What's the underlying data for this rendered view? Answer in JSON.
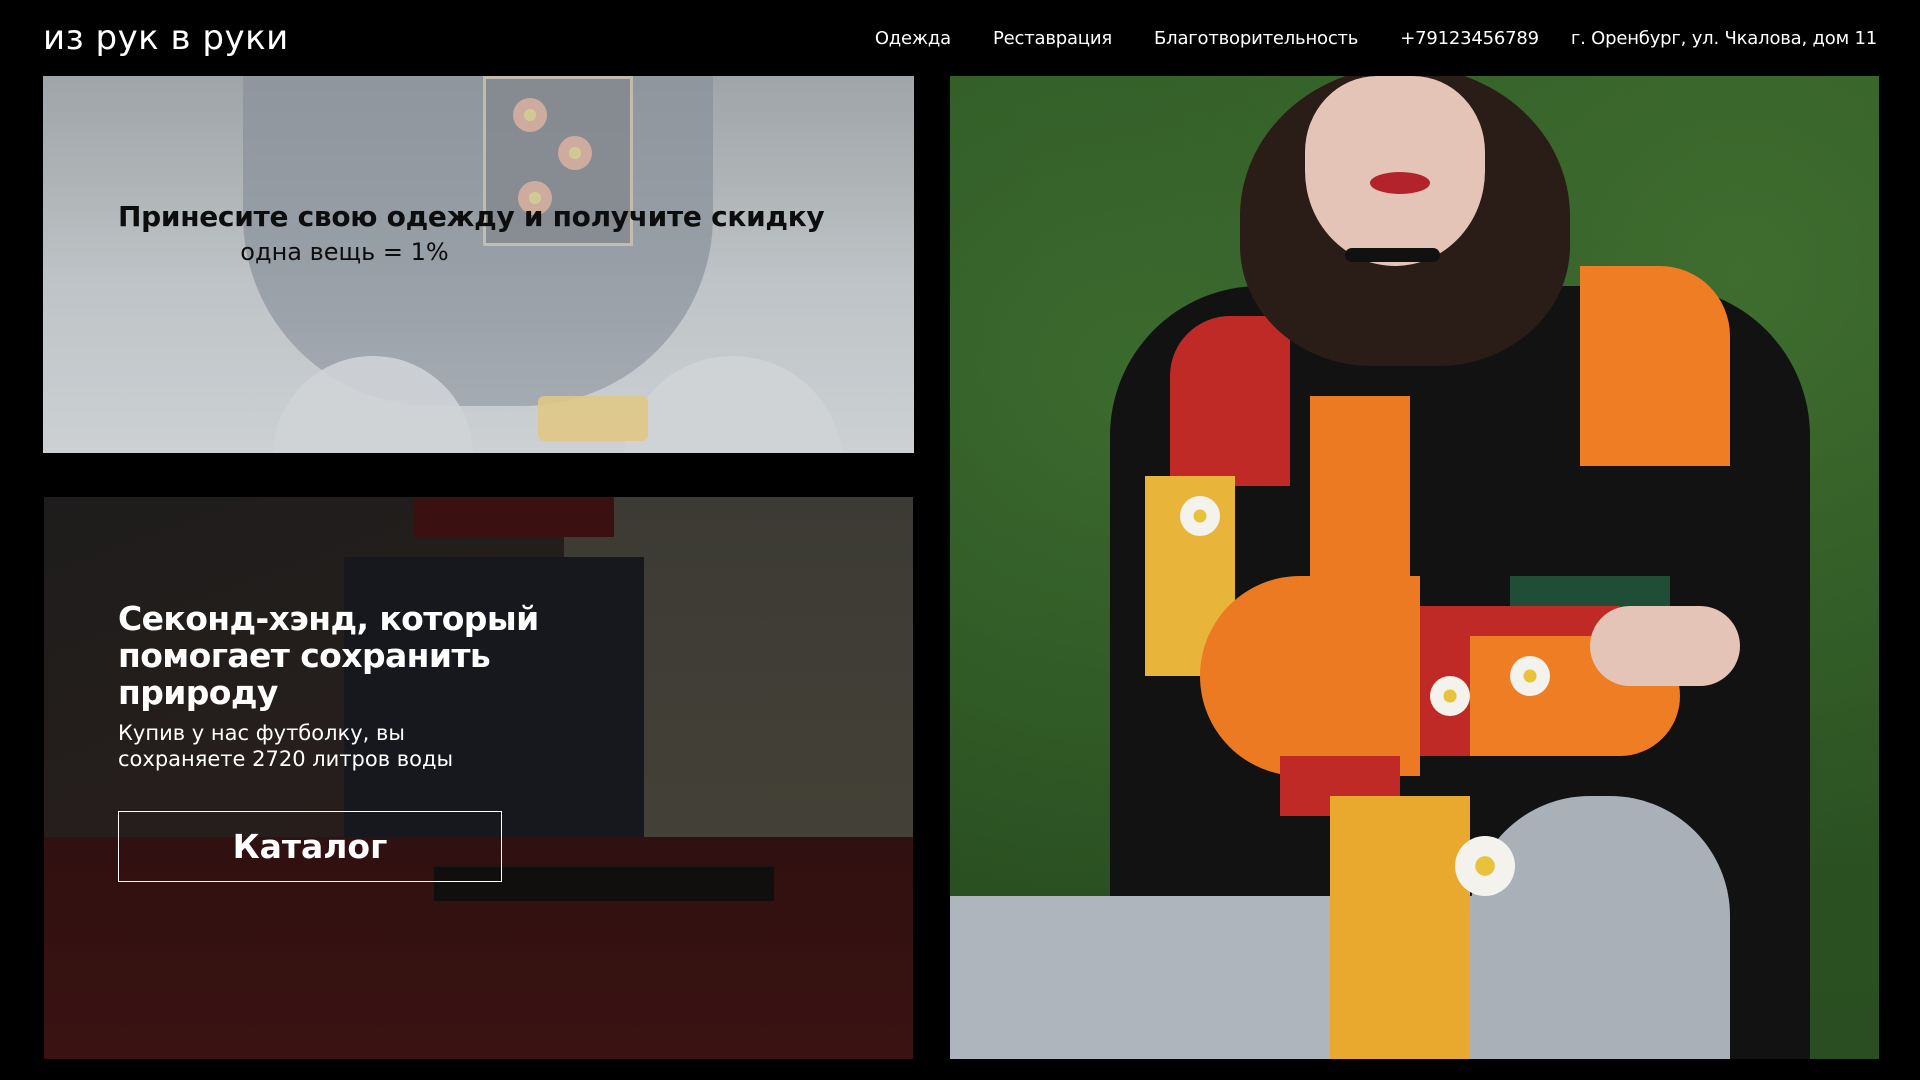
{
  "header": {
    "logo": "из рук в руки",
    "nav": [
      {
        "label": "Одежда"
      },
      {
        "label": "Реставрация"
      },
      {
        "label": "Благотворительность"
      },
      {
        "label": "+79123456789"
      },
      {
        "label": "г. Оренбург, ул. Чкалова, дом 11"
      }
    ]
  },
  "promo": {
    "title": "Принесите свою одежду и получите скидку",
    "subtitle": "одна вещь = 1%"
  },
  "eco": {
    "title": "Секонд-хэнд, который помогает сохранить природу",
    "text": "Купив у нас футболку, вы сохраняете 2720 литров воды",
    "button": "Каталог"
  },
  "colors": {
    "background": "#000000",
    "text": "#ffffff",
    "promo_text": "#0d0d0d"
  }
}
